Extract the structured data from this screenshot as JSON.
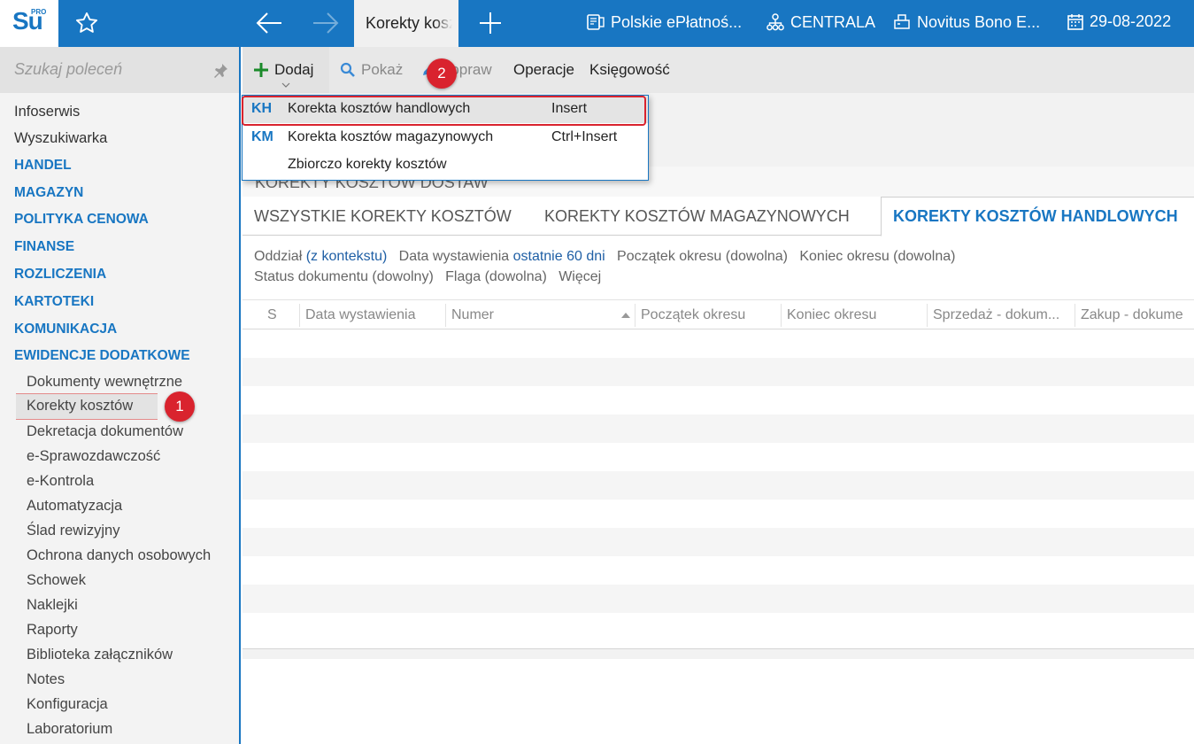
{
  "logo": {
    "text": "Su",
    "sup": "PRO"
  },
  "topbar": {
    "active_tab": "Korekty kosztów handlowych",
    "items": [
      {
        "label": "Polskie ePłatnoś...",
        "icon": "terminal-icon"
      },
      {
        "label": "CENTRALA",
        "icon": "org-structure-icon"
      },
      {
        "label": "Novitus Bono E...",
        "icon": "printer-icon"
      },
      {
        "label": "29-08-2022",
        "icon": "calendar-icon"
      }
    ]
  },
  "sidebar": {
    "search_placeholder": "Szukaj poleceń",
    "items": [
      {
        "label": "Infoserwis",
        "kind": "plain"
      },
      {
        "label": "Wyszukiwarka",
        "kind": "plain"
      },
      {
        "label": "HANDEL",
        "kind": "section"
      },
      {
        "label": "MAGAZYN",
        "kind": "section"
      },
      {
        "label": "POLITYKA CENOWA",
        "kind": "section"
      },
      {
        "label": "FINANSE",
        "kind": "section"
      },
      {
        "label": "ROZLICZENIA",
        "kind": "section"
      },
      {
        "label": "KARTOTEKI",
        "kind": "section"
      },
      {
        "label": "KOMUNIKACJA",
        "kind": "section"
      },
      {
        "label": "EWIDENCJE DODATKOWE",
        "kind": "section"
      },
      {
        "label": "Dokumenty wewnętrzne",
        "kind": "sub"
      },
      {
        "label": "Korekty kosztów",
        "kind": "sub-selected"
      },
      {
        "label": "Dekretacja dokumentów",
        "kind": "sub"
      },
      {
        "label": "e-Sprawozdawczość",
        "kind": "sub"
      },
      {
        "label": "e-Kontrola",
        "kind": "sub"
      },
      {
        "label": "Automatyzacja",
        "kind": "sub"
      },
      {
        "label": "Ślad rewizyjny",
        "kind": "sub"
      },
      {
        "label": "Ochrona danych osobowych",
        "kind": "sub"
      },
      {
        "label": "Schowek",
        "kind": "sub"
      },
      {
        "label": "Naklejki",
        "kind": "sub"
      },
      {
        "label": "Raporty",
        "kind": "sub"
      },
      {
        "label": "Biblioteka załączników",
        "kind": "sub"
      },
      {
        "label": "Notes",
        "kind": "sub"
      },
      {
        "label": "Konfiguracja",
        "kind": "sub"
      },
      {
        "label": "Laboratorium",
        "kind": "sub"
      }
    ]
  },
  "badges": {
    "one": "1",
    "two": "2"
  },
  "toolbar": {
    "dodaj": "Dodaj",
    "pokaz": "Pokaż",
    "popraw": "Popraw",
    "operacje": "Operacje",
    "ksiegowosc": "Księgowość"
  },
  "menu": {
    "items": [
      {
        "code": "KH",
        "label": "Korekta kosztów handlowych",
        "shortcut": "Insert"
      },
      {
        "code": "KM",
        "label": "Korekta kosztów magazynowych",
        "shortcut": "Ctrl+Insert"
      },
      {
        "code": "",
        "label": "Zbiorczo korekty kosztów",
        "shortcut": ""
      }
    ]
  },
  "page_title": "KOREKTY KOSZTÓW DOSTAW",
  "tabs": {
    "all": "WSZYSTKIE KOREKTY KOSZTÓW",
    "magazynowe": "KOREKTY KOSZTÓW MAGAZYNOWYCH",
    "handlowe": "KOREKTY KOSZTÓW HANDLOWYCH"
  },
  "filters": {
    "oddzial_label": "Oddział",
    "oddzial_value": "(z kontekstu)",
    "data_label": "Data wystawienia",
    "data_value": "ostatnie 60 dni",
    "poczatek": "Początek okresu (dowolna)",
    "koniec": "Koniec okresu (dowolna)",
    "status": "Status dokumentu (dowolny)",
    "flaga": "Flaga (dowolna)",
    "wiecej": "Więcej"
  },
  "grid": {
    "columns": [
      "S",
      "Data wystawienia",
      "Numer",
      "Początek okresu",
      "Koniec okresu",
      "Sprzedaż - dokum...",
      "Zakup - dokume"
    ]
  },
  "colors": {
    "accent": "#1876c2",
    "highlight": "#d9232e"
  }
}
